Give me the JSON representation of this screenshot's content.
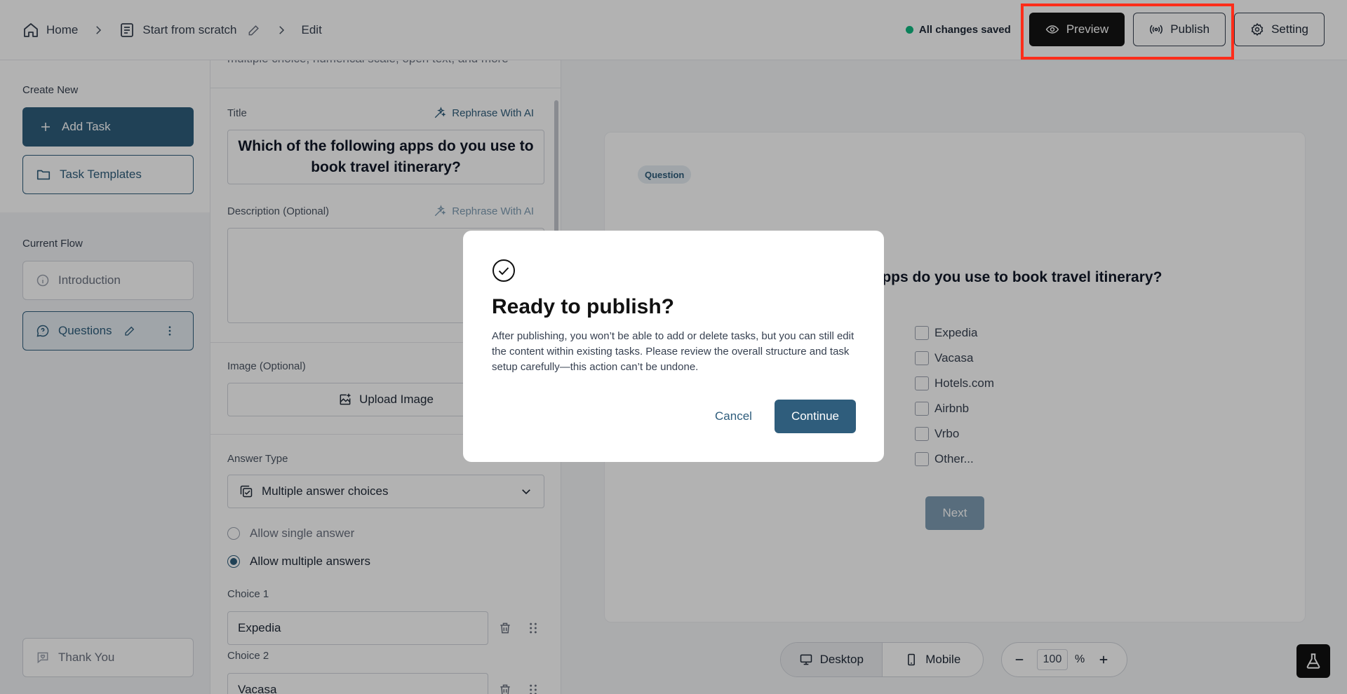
{
  "header": {
    "breadcrumb": [
      {
        "label": "Home",
        "icon": "home-icon"
      },
      {
        "label": "Start from scratch",
        "icon": "document-icon"
      },
      {
        "label": "Edit"
      }
    ],
    "status": "All changes saved",
    "status_color": "#10b981",
    "preview_label": "Preview",
    "publish_label": "Publish",
    "setting_label": "Setting"
  },
  "sidebar": {
    "create_new_label": "Create New",
    "add_task_label": "Add Task",
    "templates_label": "Task Templates",
    "current_flow_label": "Current Flow",
    "flow_items": [
      {
        "label": "Introduction",
        "icon": "info-icon"
      },
      {
        "label": "Questions",
        "icon": "chat-icon",
        "active": true
      }
    ],
    "thank_you_label": "Thank You"
  },
  "editor": {
    "cut_text": "multiple choice, numerical scale, open text, and more",
    "title_label": "Title",
    "rephrase_label": "Rephrase With AI",
    "title_value": "Which of the following apps do you use to book travel itinerary?",
    "description_label": "Description (Optional)",
    "description_value": "",
    "image_label": "Image (Optional)",
    "upload_label": "Upload Image",
    "answer_type_label": "Answer Type",
    "answer_type_value": "Multiple answer choices",
    "single_answer_label": "Allow single answer",
    "multiple_answers_label": "Allow multiple answers",
    "selected_mode": "multiple",
    "choices": [
      {
        "label": "Choice 1",
        "value": "Expedia"
      },
      {
        "label": "Choice 2",
        "value": "Vacasa"
      }
    ]
  },
  "preview": {
    "badge": "Question",
    "question_visible": "g apps do you use to book travel itinerary?",
    "options": [
      "Expedia",
      "Vacasa",
      "Hotels.com",
      "Airbnb",
      "Vrbo",
      "Other..."
    ],
    "next_label": "Next",
    "device_desktop": "Desktop",
    "device_mobile": "Mobile",
    "zoom_value": "100",
    "zoom_unit": "%"
  },
  "modal": {
    "title": "Ready to publish?",
    "body": "After publishing, you won’t be able to add or delete tasks, but you can still edit the content within existing tasks. Please review the overall structure and task setup carefully—this action can’t be undone.",
    "cancel_label": "Cancel",
    "continue_label": "Continue"
  },
  "colors": {
    "accent": "#2f5d7c",
    "highlight_box": "#ff2d1a"
  }
}
